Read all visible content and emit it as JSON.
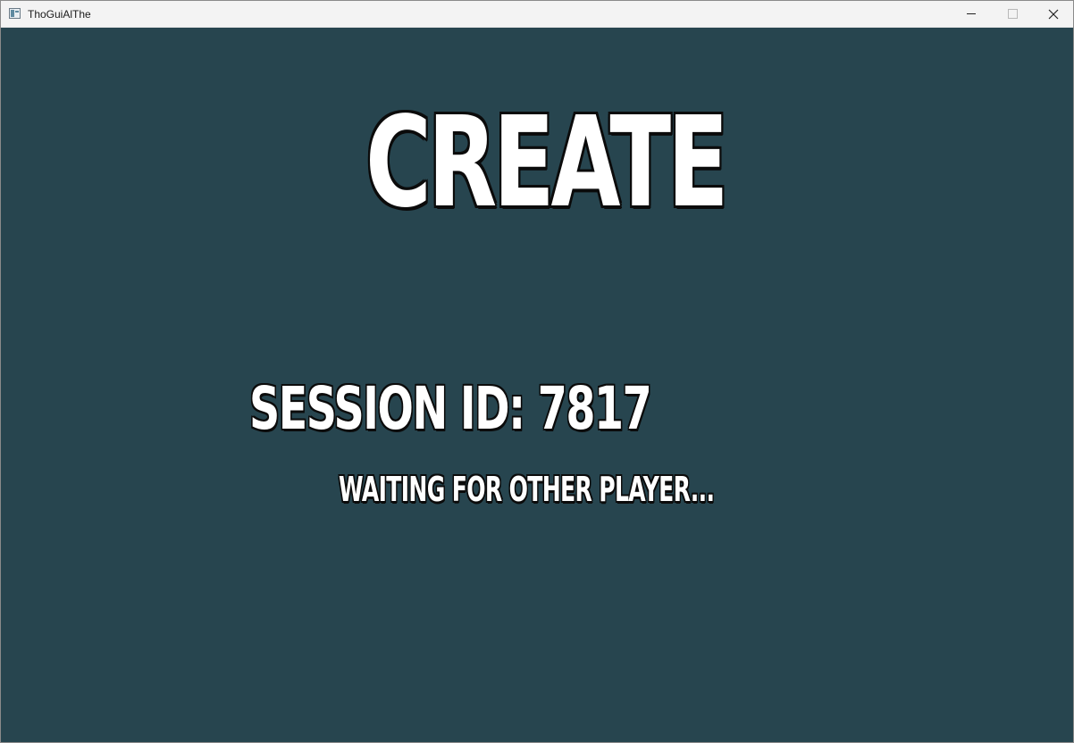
{
  "window": {
    "title": "ThoGuiAlThe",
    "icon": "app-window-icon",
    "controls": {
      "minimize_icon": "minimize-icon",
      "maximize_icon": "maximize-icon",
      "close_icon": "close-icon"
    }
  },
  "screen": {
    "title": "CREATE",
    "session_label": "SESSION ID:",
    "session_id": "7817",
    "status": "WAITING FOR OTHER PLAYER..."
  },
  "colors": {
    "background": "#27454f",
    "text": "#ffffff",
    "outline": "#0b0b0b",
    "titlebar": "#f3f3f3"
  }
}
